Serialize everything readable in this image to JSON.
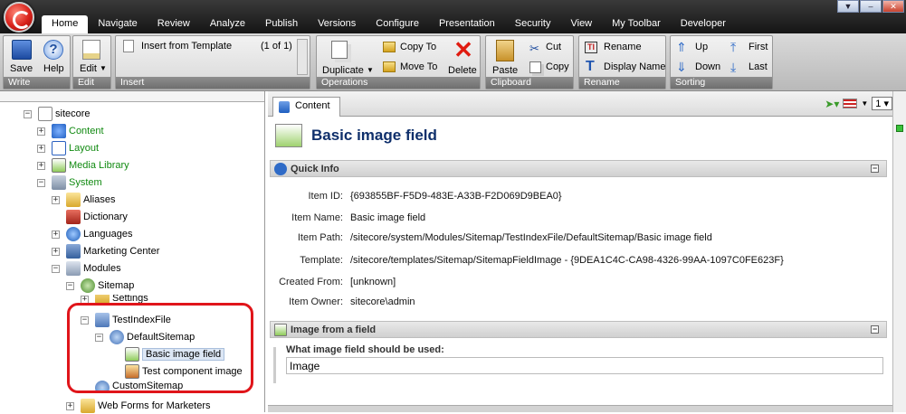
{
  "tabs": [
    "Home",
    "Navigate",
    "Review",
    "Analyze",
    "Publish",
    "Versions",
    "Configure",
    "Presentation",
    "Security",
    "View",
    "My Toolbar",
    "Developer"
  ],
  "active_tab": "Home",
  "window_controls": [
    "▼",
    "–",
    "✕"
  ],
  "ribbon": {
    "write": {
      "label": "Write",
      "save": "Save",
      "help": "Help"
    },
    "edit": {
      "label": "Edit",
      "edit": "Edit"
    },
    "insert": {
      "label": "Insert",
      "insert_from_template": "Insert from Template",
      "count": "(1 of 1)"
    },
    "operations": {
      "label": "Operations",
      "duplicate": "Duplicate",
      "copy_to": "Copy To",
      "move_to": "Move To",
      "delete": "Delete"
    },
    "clipboard": {
      "label": "Clipboard",
      "paste": "Paste",
      "cut": "Cut",
      "copy": "Copy"
    },
    "rename": {
      "label": "Rename",
      "rename": "Rename",
      "display_name": "Display Name"
    },
    "sorting": {
      "label": "Sorting",
      "up": "Up",
      "down": "Down",
      "first": "First",
      "last": "Last"
    }
  },
  "tree": {
    "sitecore": "sitecore",
    "content": "Content",
    "layout": "Layout",
    "media_library": "Media Library",
    "system": "System",
    "aliases": "Aliases",
    "dictionary": "Dictionary",
    "languages": "Languages",
    "marketing_center": "Marketing Center",
    "modules": "Modules",
    "sitemap": "Sitemap",
    "settings": "Settings",
    "testindexfile": "TestIndexFile",
    "defaultsitemap": "DefaultSitemap",
    "basic_image_field": "Basic image field",
    "test_component_image": "Test component image",
    "customsitemap": "CustomSitemap",
    "web_forms": "Web Forms for Marketers"
  },
  "content": {
    "tab": "Content",
    "version": "1",
    "title": "Basic image field",
    "quick_info": {
      "header": "Quick Info",
      "item_id_label": "Item ID:",
      "item_id": "{693855BF-F5D9-483E-A33B-F2D069D9BEA0}",
      "item_name_label": "Item Name:",
      "item_name": "Basic image field",
      "item_path_label": "Item Path:",
      "item_path": "/sitecore/system/Modules/Sitemap/TestIndexFile/DefaultSitemap/Basic image field",
      "template_label": "Template:",
      "template": "/sitecore/templates/Sitemap/SitemapFieldImage - {9DEA1C4C-CA98-4326-99AA-1097C0FE623F}",
      "created_from_label": "Created From:",
      "created_from": "[unknown]",
      "item_owner_label": "Item Owner:",
      "item_owner": "sitecore\\admin"
    },
    "image_section": {
      "header": "Image from a field",
      "question": "What image field should be used:",
      "value": "Image"
    }
  },
  "colors": {
    "accent": "#0f2f6b",
    "tree_green": "#118a11",
    "highlight_box": "#e0151a"
  }
}
